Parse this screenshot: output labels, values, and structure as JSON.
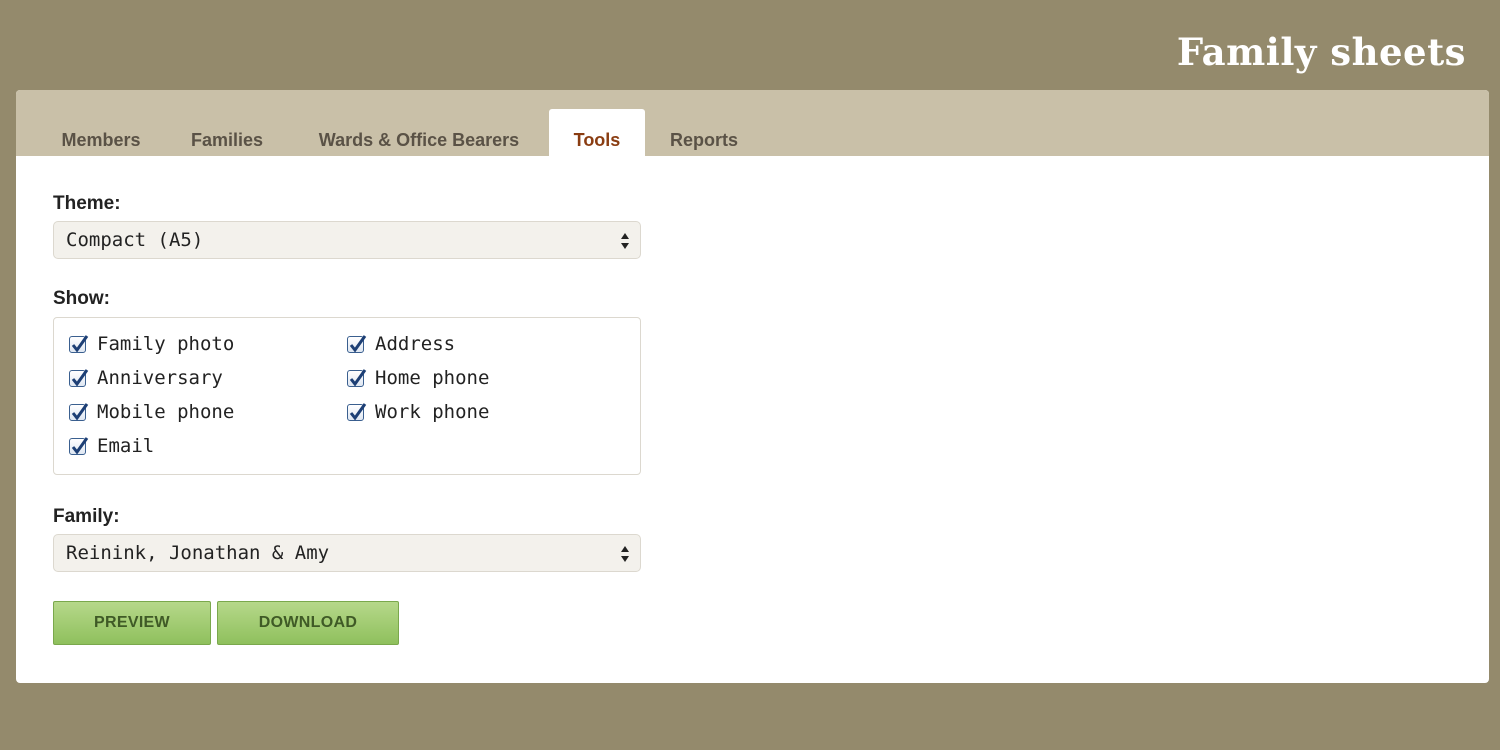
{
  "header": {
    "title": "Family sheets"
  },
  "tabs": [
    {
      "label": "Members",
      "active": false
    },
    {
      "label": "Families",
      "active": false
    },
    {
      "label": "Wards & Office Bearers",
      "active": false
    },
    {
      "label": "Tools",
      "active": true
    },
    {
      "label": "Reports",
      "active": false
    }
  ],
  "form": {
    "theme": {
      "label": "Theme:",
      "value": "Compact (A5)"
    },
    "show": {
      "label": "Show:",
      "options": [
        {
          "label": "Family photo",
          "checked": true
        },
        {
          "label": "Address",
          "checked": true
        },
        {
          "label": "Anniversary",
          "checked": true
        },
        {
          "label": "Home phone",
          "checked": true
        },
        {
          "label": "Mobile phone",
          "checked": true
        },
        {
          "label": "Work phone",
          "checked": true
        },
        {
          "label": "Email",
          "checked": true
        }
      ]
    },
    "family": {
      "label": "Family:",
      "value": "Reinink, Jonathan & Amy"
    },
    "buttons": {
      "preview": "PREVIEW",
      "download": "DOWNLOAD"
    }
  },
  "colors": {
    "background": "#948a6c",
    "tabbar": "#c9c0a8",
    "active_tab_text": "#8a3d12",
    "button_green": "#9cc96b"
  },
  "icons": {
    "checkbox": "checkmark-icon",
    "select_arrows": "up-down-arrows-icon"
  }
}
